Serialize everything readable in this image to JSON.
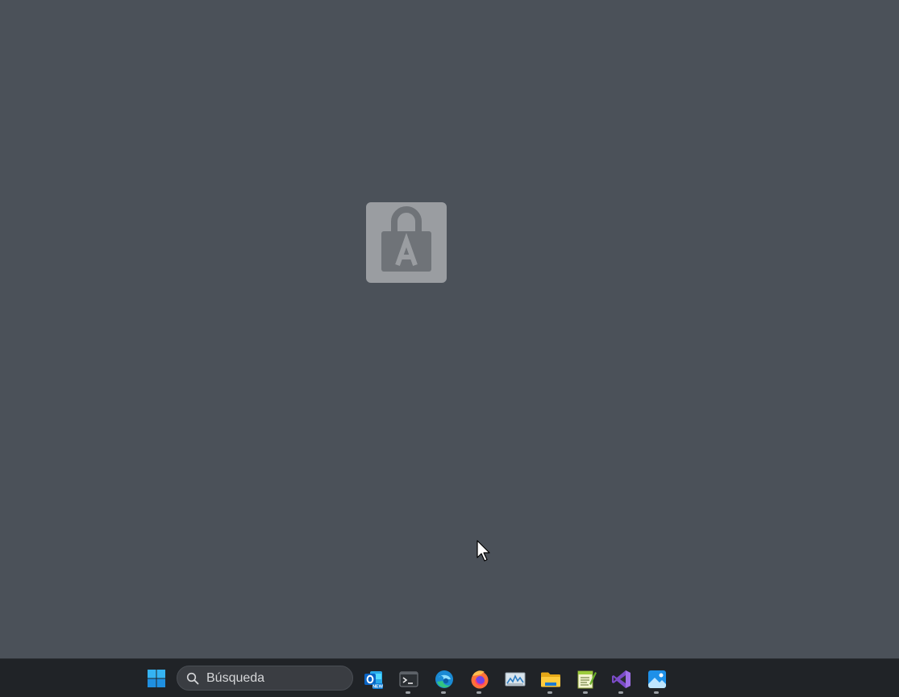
{
  "desktop": {
    "lock_icon": "keyboard-lock-icon",
    "cursor_icon": "mouse-pointer-icon"
  },
  "taskbar": {
    "start_icon": "windows-start-icon",
    "search": {
      "icon": "search-icon",
      "placeholder": "Búsqueda"
    },
    "apps": [
      {
        "name": "outlook-new-icon",
        "badge": "NEW",
        "running": false
      },
      {
        "name": "terminal-icon",
        "running": true
      },
      {
        "name": "edge-icon",
        "running": true
      },
      {
        "name": "firefox-icon",
        "running": true
      },
      {
        "name": "resource-monitor-icon",
        "running": false
      },
      {
        "name": "file-explorer-icon",
        "running": true
      },
      {
        "name": "notepad-plus-icon",
        "running": true
      },
      {
        "name": "visual-studio-icon",
        "running": true
      },
      {
        "name": "photos-icon",
        "running": true
      }
    ]
  },
  "colors": {
    "desktop": "#4b5159",
    "taskbar": "#202327",
    "accent": "#0a7ad6"
  }
}
